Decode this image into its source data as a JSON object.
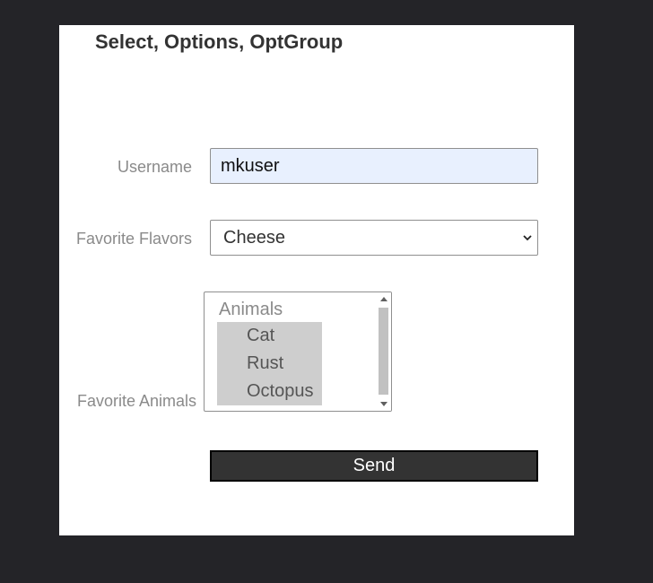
{
  "page": {
    "title": "Select, Options, OptGroup"
  },
  "form": {
    "username": {
      "label": "Username",
      "value": "mkuser"
    },
    "favorite_flavors": {
      "label": "Favorite Flavors",
      "selected": "Cheese"
    },
    "favorite_animals": {
      "label": "Favorite Animals",
      "optgroup_label": "Animals",
      "options": [
        "Cat",
        "Rust",
        "Octopus"
      ]
    },
    "send_label": "Send"
  },
  "colors": {
    "page_background": "#242428",
    "panel_background": "#ffffff",
    "input_autofill": "#e8f0fe",
    "option_selected": "#cecece",
    "button_background": "#333333"
  },
  "icons": {
    "select_arrow": "chevron-down-icon",
    "scroll_up": "scroll-up-arrow-icon",
    "scroll_down": "scroll-down-arrow-icon"
  }
}
